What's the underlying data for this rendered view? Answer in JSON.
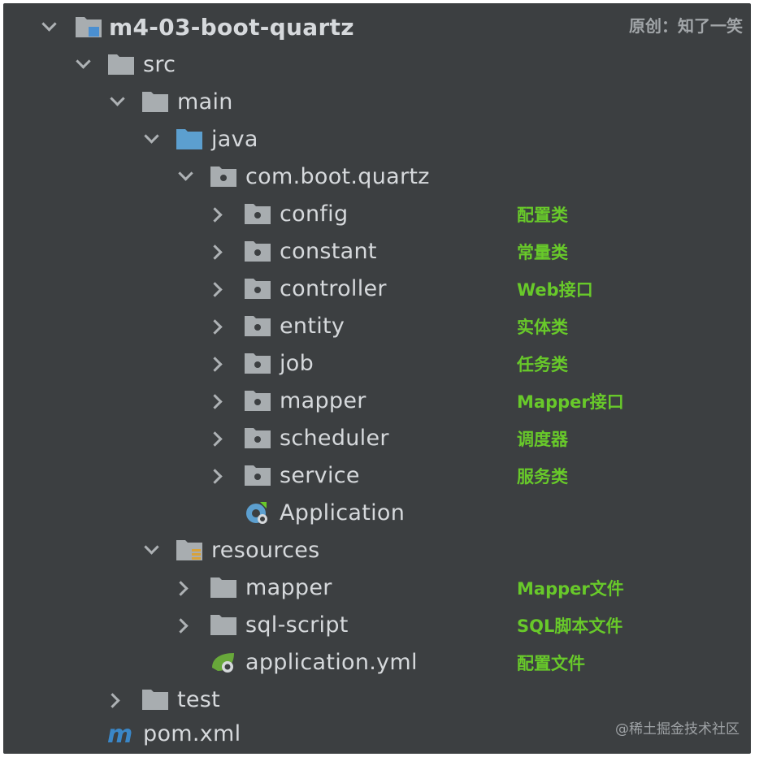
{
  "credit": "原创：知了一笑",
  "watermark": "@稀土掘金技术社区",
  "tree": {
    "project": "m4-03-boot-quartz",
    "src": "src",
    "main": "main",
    "java": "java",
    "package": "com.boot.quartz",
    "config": "config",
    "constant": "constant",
    "controller": "controller",
    "entity": "entity",
    "job": "job",
    "mapper": "mapper",
    "scheduler": "scheduler",
    "service": "service",
    "application_class": "Application",
    "resources": "resources",
    "res_mapper": "mapper",
    "sql_script": "sql-script",
    "application_yml": "application.yml",
    "test": "test",
    "pom": "pom.xml"
  },
  "notes": {
    "config": "配置类",
    "constant": "常量类",
    "controller": "Web接口",
    "entity": "实体类",
    "job": "任务类",
    "mapper": "Mapper接口",
    "scheduler": "调度器",
    "service": "服务类",
    "res_mapper": "Mapper文件",
    "sql_script": "SQL脚本文件",
    "application_yml": "配置文件"
  },
  "colors": {
    "panel": "#3c3f41",
    "text": "#d6d9dc",
    "note_green": "#68c92a",
    "folder_gray": "#a8adb0",
    "java_folder_blue": "#5c9fcf",
    "maven_blue": "#3a87c8"
  }
}
